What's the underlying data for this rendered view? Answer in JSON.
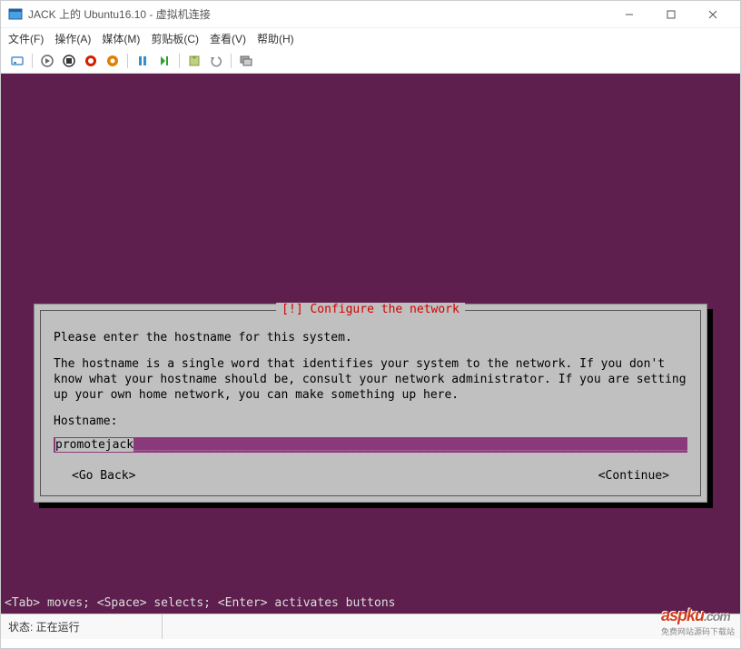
{
  "window": {
    "title": "JACK 上的 Ubuntu16.10 - 虚拟机连接"
  },
  "menu": {
    "file": "文件(F)",
    "action": "操作(A)",
    "media": "媒体(M)",
    "clipboard": "剪贴板(C)",
    "view": "查看(V)",
    "help": "帮助(H)"
  },
  "dialog": {
    "title": "[!] Configure the network",
    "intro": "Please enter the hostname for this system.",
    "body": "The hostname is a single word that identifies your system to the network. If you don't know what your hostname should be, consult your network administrator. If you are setting up your own home network, you can make something up here.",
    "hostname_label": "Hostname:",
    "hostname_value": "promotejack",
    "go_back": "<Go Back>",
    "continue": "<Continue>"
  },
  "hint": "<Tab> moves; <Space> selects; <Enter> activates buttons",
  "status": {
    "text": "状态: 正在运行"
  },
  "watermark": {
    "main": "aspku",
    "tld": ".com",
    "sub": "免费网站源码下载站"
  }
}
